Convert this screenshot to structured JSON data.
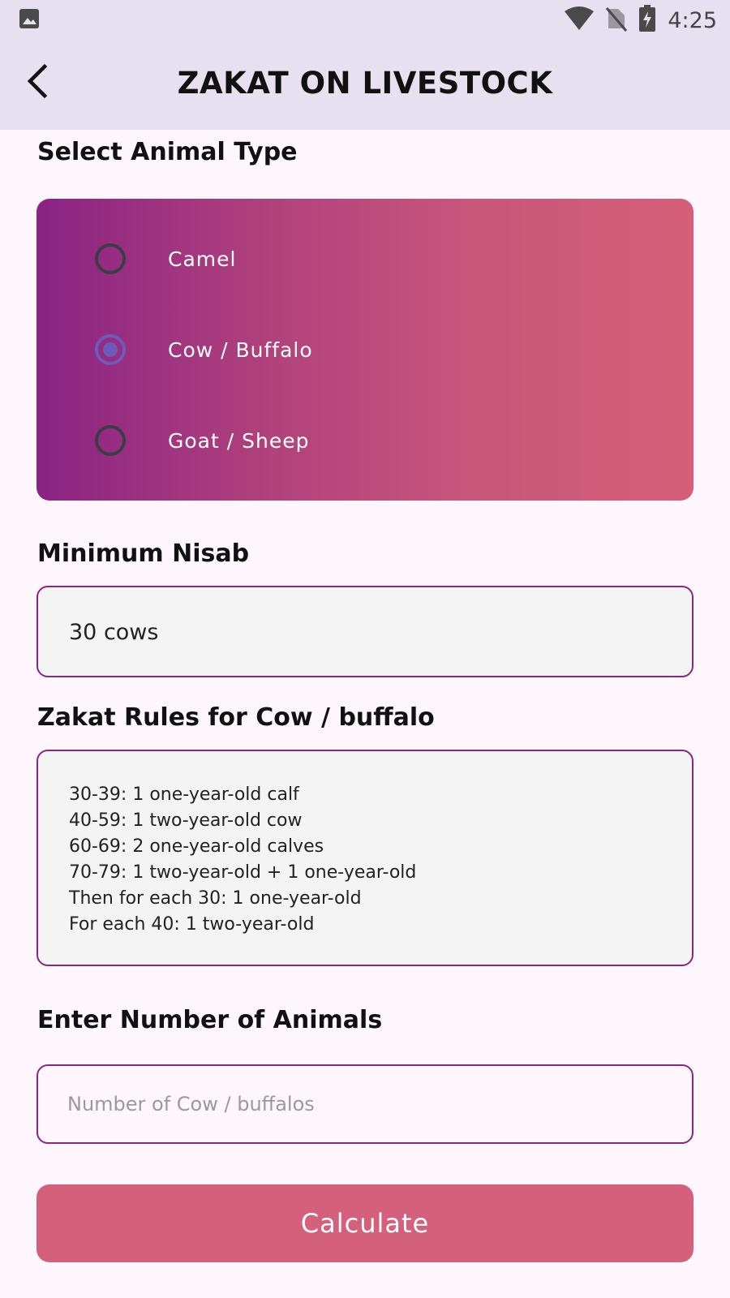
{
  "status_bar": {
    "time": "4:25",
    "icons": [
      "image-icon",
      "wifi-icon",
      "no-sim-icon",
      "battery-charging-icon"
    ]
  },
  "app_bar": {
    "title": "ZAKAT ON LIVESTOCK",
    "back_icon": "back-arrow-icon"
  },
  "animal_section": {
    "label": "Select Animal Type",
    "options": [
      {
        "label": "Camel",
        "selected": false
      },
      {
        "label": "Cow / Buffalo",
        "selected": true
      },
      {
        "label": "Goat / Sheep",
        "selected": false
      }
    ]
  },
  "nisab_section": {
    "label": "Minimum Nisab",
    "value": "30 cows"
  },
  "rules_section": {
    "label": "Zakat Rules for Cow / buffalo",
    "lines": [
      "30-39: 1 one-year-old calf",
      "40-59: 1 two-year-old cow",
      "60-69: 2 one-year-old calves",
      "70-79: 1 two-year-old + 1 one-year-old",
      "Then for each 30: 1 one-year-old",
      "For each 40: 1 two-year-old"
    ]
  },
  "count_section": {
    "label": "Enter Number of Animals",
    "placeholder": "Number of Cow / buffalos",
    "value": ""
  },
  "calculate_button": {
    "label": "Calculate"
  },
  "colors": {
    "app_bar": "#e6e0f0",
    "background": "#fdf7fd",
    "gradient_start": "#8a2384",
    "gradient_end": "#d55f78",
    "field_border": "#8b2582",
    "radio_selected": "#6c5bb8",
    "button": "#d4607b"
  }
}
